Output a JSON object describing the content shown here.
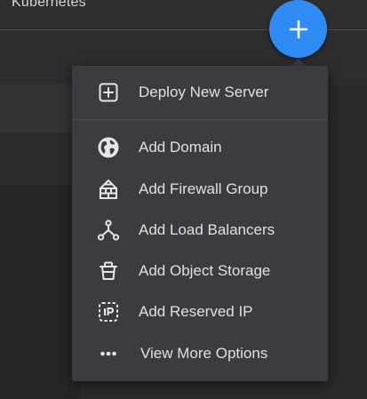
{
  "header": {
    "title": "Kubernetes"
  },
  "fab": {
    "icon": "plus-icon",
    "color": "#2f8cf5"
  },
  "menu": {
    "primary": {
      "label": "Deploy New Server",
      "icon": "server-plus-icon"
    },
    "items": [
      {
        "label": "Add Domain",
        "icon": "globe-icon"
      },
      {
        "label": "Add Firewall Group",
        "icon": "firewall-icon"
      },
      {
        "label": "Add Load Balancers",
        "icon": "load-balancer-icon"
      },
      {
        "label": "Add Object Storage",
        "icon": "object-storage-icon"
      },
      {
        "label": "Add Reserved IP",
        "icon": "reserved-ip-icon"
      },
      {
        "label": "View More Options",
        "icon": "more-icon"
      }
    ]
  }
}
